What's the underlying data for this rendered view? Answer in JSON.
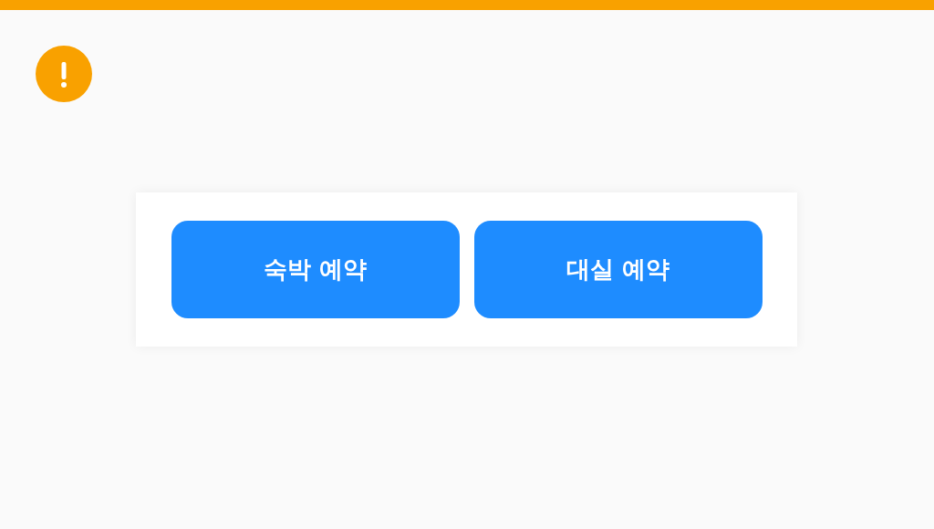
{
  "buttons": [
    {
      "label": "숙박 예약"
    },
    {
      "label": "대실 예약"
    }
  ]
}
